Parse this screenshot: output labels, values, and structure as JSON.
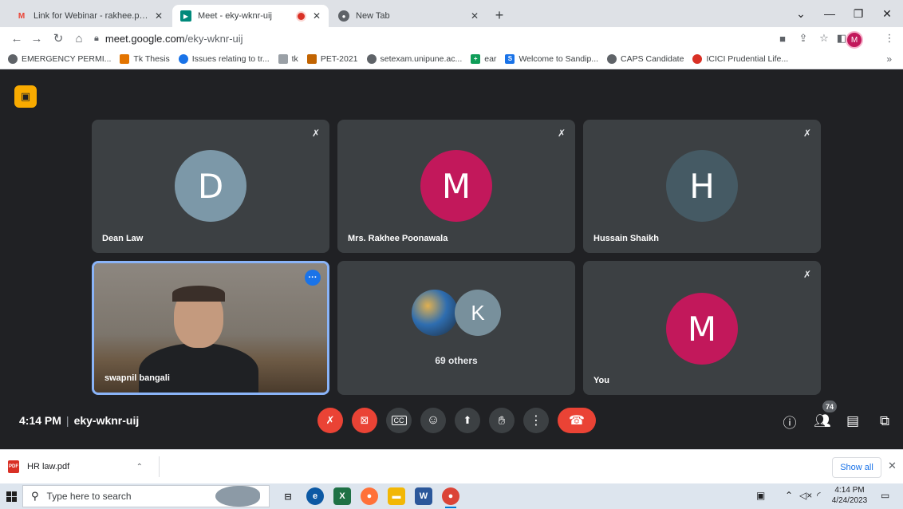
{
  "browser": {
    "tabs": [
      {
        "title": "Link for Webinar - rakhee.poonawala",
        "favicon": "gmail-icon"
      },
      {
        "title": "Meet - eky-wknr-uij",
        "favicon": "meet-icon",
        "active": true,
        "recording": true
      },
      {
        "title": "New Tab",
        "favicon": "chrome-icon"
      }
    ],
    "url_host": "meet.google.com",
    "url_path": "/eky-wknr-uij",
    "profile_initial": "M"
  },
  "bookmarks": [
    {
      "label": "EMERGENCY PERMI...",
      "icon_color": "#5f6368"
    },
    {
      "label": "Tk Thesis",
      "icon_color": "#e37400"
    },
    {
      "label": "Issues relating to tr...",
      "icon_color": "#1a73e8"
    },
    {
      "label": "tk",
      "icon_color": "#5f6368"
    },
    {
      "label": "PET-2021",
      "icon_color": "#c26401"
    },
    {
      "label": "setexam.unipune.ac...",
      "icon_color": "#5f6368"
    },
    {
      "label": "ear",
      "icon_color": "#0f9d58"
    },
    {
      "label": "Welcome to Sandip...",
      "icon_color": "#1a73e8"
    },
    {
      "label": "CAPS Candidate",
      "icon_color": "#5f6368"
    },
    {
      "label": "ICICI Prudential Life...",
      "icon_color": "#d93025"
    }
  ],
  "meet": {
    "participants": [
      {
        "name": "Dean Law",
        "initial": "D",
        "color": "#7c98a8",
        "muted": true
      },
      {
        "name": "Mrs. Rakhee Poonawala",
        "initial": "M",
        "color": "#c2185b",
        "muted": true
      },
      {
        "name": "Hussain Shaikh",
        "initial": "H",
        "color": "#455a64",
        "muted": true
      },
      {
        "name": "swapnil bangali",
        "video": true
      },
      {
        "name": "69 others",
        "initial": "K",
        "color": "#78909c"
      },
      {
        "name": "You",
        "initial": "M",
        "color": "#c2185b",
        "muted": true
      }
    ],
    "time": "4:14 PM",
    "meeting_code": "eky-wknr-uij",
    "participant_count": "74",
    "accent_red": "#ea4335"
  },
  "downloads": {
    "file_name": "HR law.pdf",
    "show_all_label": "Show all"
  },
  "taskbar": {
    "search_placeholder": "Type here to search",
    "clock_time": "4:14 PM",
    "clock_date": "4/24/2023"
  }
}
